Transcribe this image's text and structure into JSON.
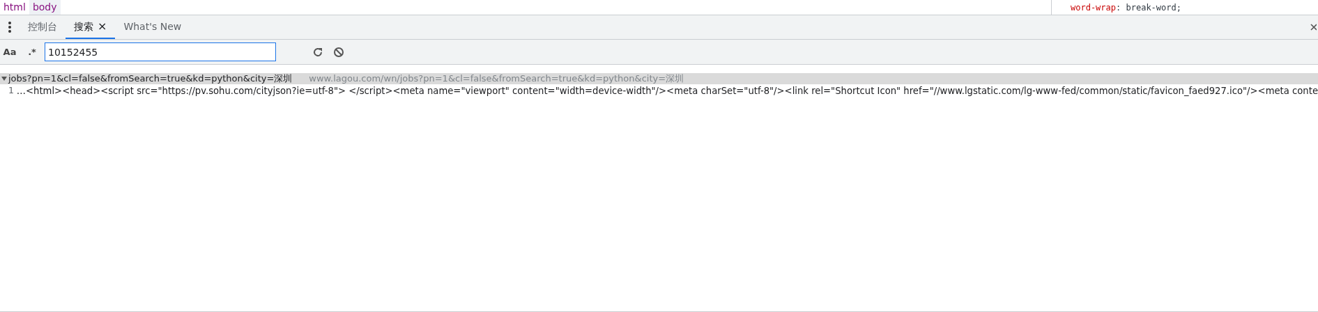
{
  "breadcrumbs": [
    {
      "label": "html",
      "selected": false
    },
    {
      "label": "body",
      "selected": true
    }
  ],
  "styles_line": {
    "property": "word-wrap",
    "separator": ":",
    "value": "break-word;"
  },
  "tabs": [
    {
      "label": "控制台",
      "selected": false,
      "closable": false
    },
    {
      "label": "搜索",
      "selected": true,
      "closable": true,
      "close": "×"
    },
    {
      "label": "What's New",
      "selected": false,
      "closable": false
    }
  ],
  "search": {
    "case_toggle": "Aa",
    "regex_toggle": ".*",
    "value": "10152455"
  },
  "results": [
    {
      "file": "jobs?pn=1&cl=false&fromSearch=true&kd=python&city=深圳",
      "url": "www.lagou.com/wn/jobs?pn=1&cl=false&fromSearch=true&kd=python&city=深圳",
      "expanded": true,
      "matches": [
        {
          "line": "1",
          "text": "…<html><head><script src=\"https://pv.sohu.com/cityjson?ie=utf-8\"> </script><meta name=\"viewport\" content=\"width=device-width\"/><meta charSet=\"utf-8\"/><link rel=\"Shortcut Icon\" href=\"//www.lgstatic.com/lg-www-fed/common/static/favicon_faed927.ico\"/><meta conte"
        }
      ]
    }
  ]
}
